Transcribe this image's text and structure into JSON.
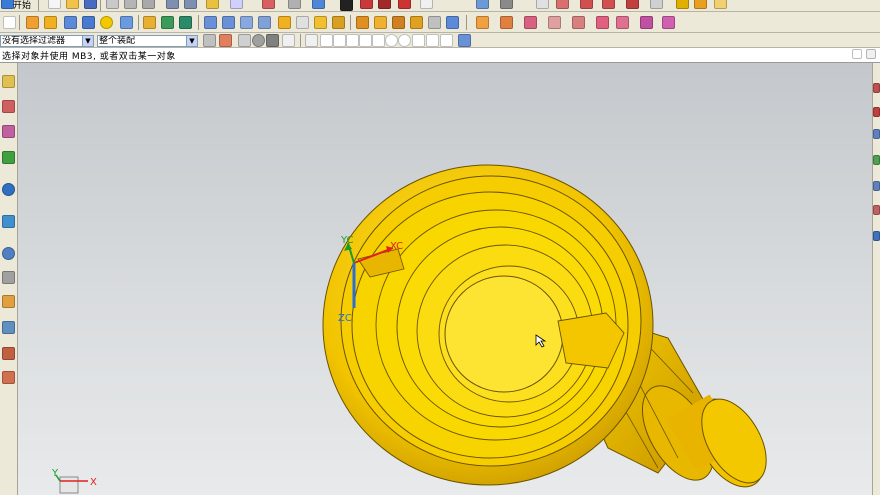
{
  "menu": {
    "start_label": "开始"
  },
  "selection_bar": {
    "filter_combo": {
      "value": "没有选择过滤器"
    },
    "scope_combo": {
      "value": "整个装配"
    }
  },
  "cue_line": {
    "text": "选择对象并使用 MB3, 或者双击某一对象"
  },
  "viewport": {
    "wcs": {
      "x_label": "XC",
      "y_label": "YC",
      "z_label": "ZC"
    },
    "triad": {
      "x_label": "X",
      "y_label": "Y"
    }
  },
  "colors": {
    "part_yellow": "#f2cc00",
    "part_shadow": "#c79800",
    "axis_red": "#e02020",
    "axis_green": "#1e9a2a",
    "axis_blue": "#2a6fd6",
    "toolbar_bg": "#ece9d8"
  }
}
